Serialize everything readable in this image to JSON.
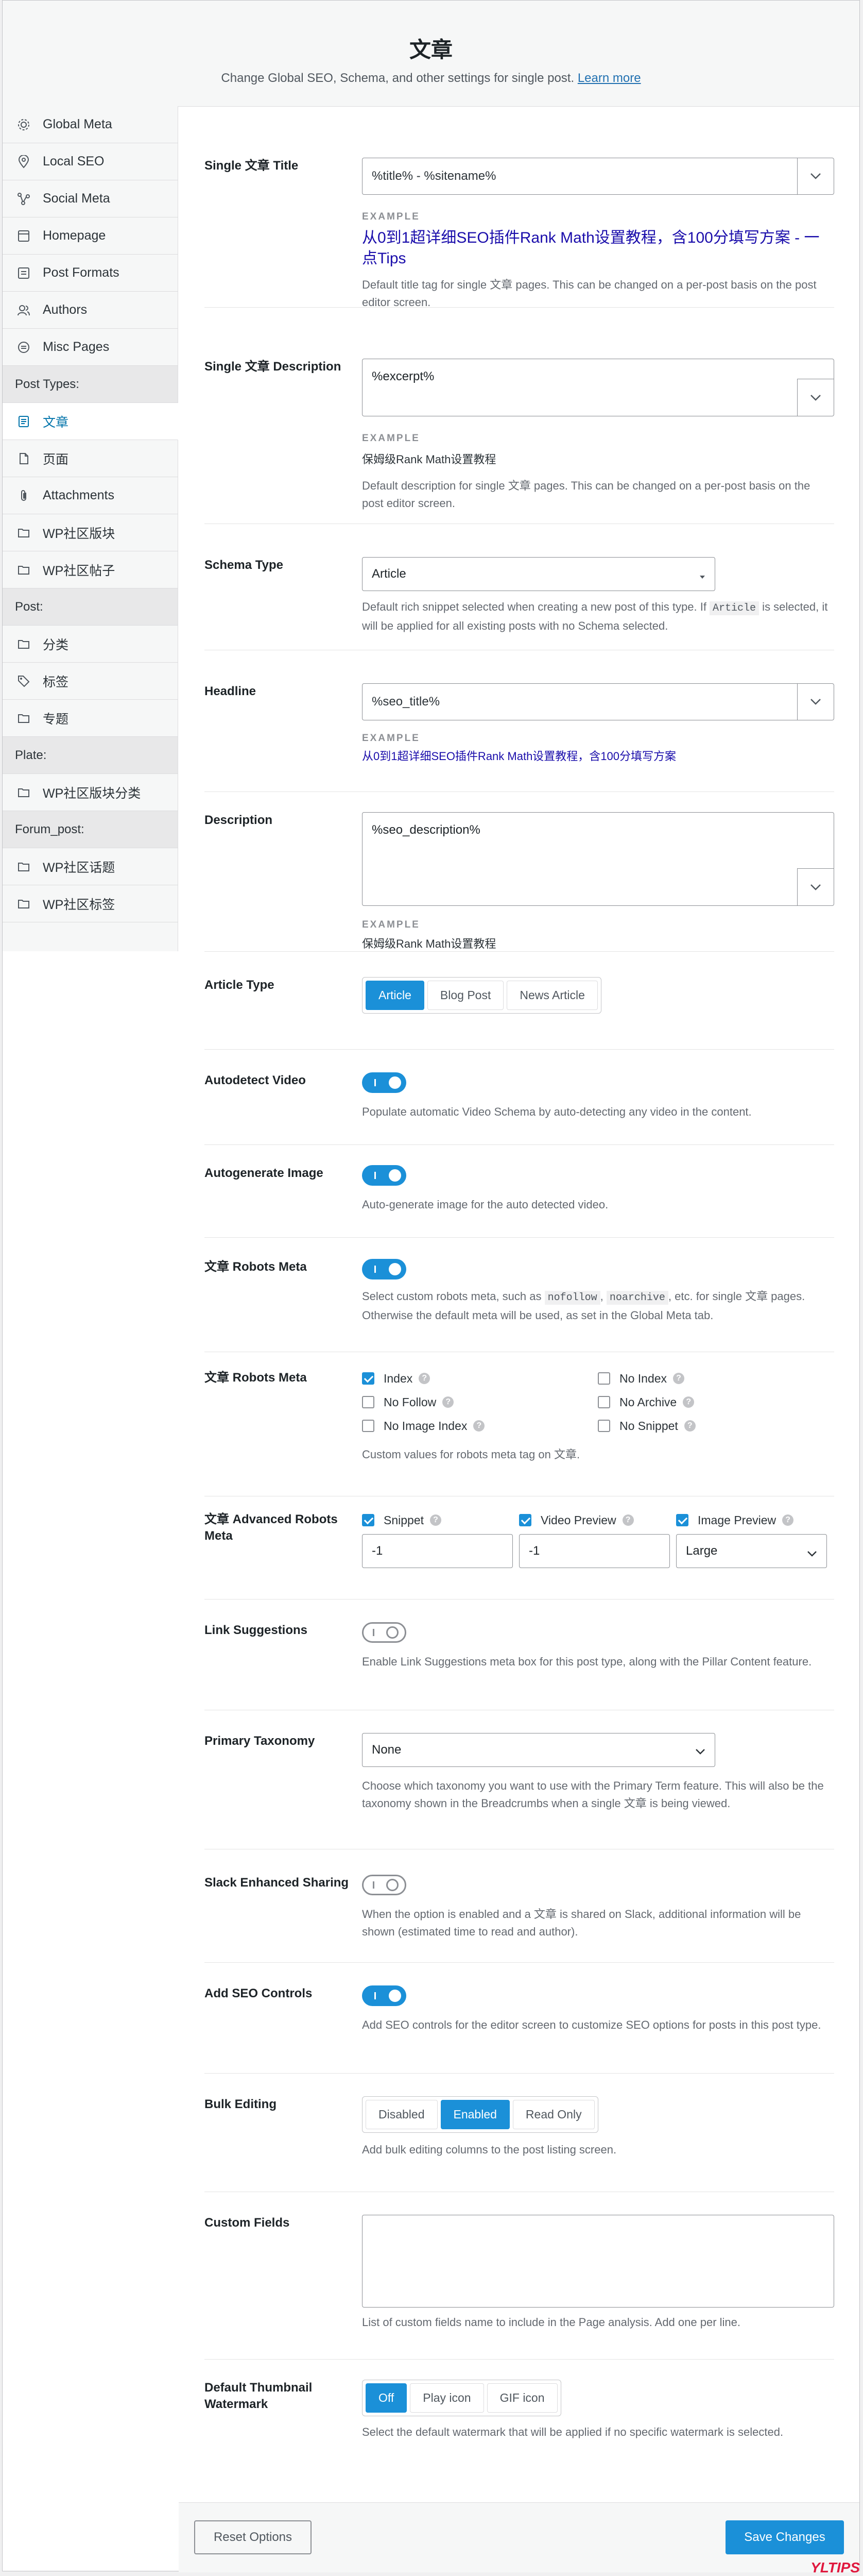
{
  "header": {
    "title": "文章",
    "subtitle": "Change Global SEO, Schema, and other settings for single post.",
    "learn_more": "Learn more"
  },
  "sidebar": {
    "items_top": [
      {
        "label": "Global Meta",
        "icon": "gear-icon"
      },
      {
        "label": "Local SEO",
        "icon": "map-pin-icon"
      },
      {
        "label": "Social Meta",
        "icon": "social-icon"
      },
      {
        "label": "Homepage",
        "icon": "home-icon"
      },
      {
        "label": "Post Formats",
        "icon": "post-format-icon"
      },
      {
        "label": "Authors",
        "icon": "users-icon"
      },
      {
        "label": "Misc Pages",
        "icon": "misc-icon"
      }
    ],
    "section_post_types": "Post Types:",
    "post_types": [
      {
        "label": "文章",
        "icon": "document-icon",
        "active": true
      },
      {
        "label": "页面",
        "icon": "page-icon"
      },
      {
        "label": "Attachments",
        "icon": "paperclip-icon"
      },
      {
        "label": "WP社区版块",
        "icon": "folder-icon"
      },
      {
        "label": "WP社区帖子",
        "icon": "folder-icon"
      }
    ],
    "section_post": "Post:",
    "post": [
      {
        "label": "分类",
        "icon": "folder-icon"
      },
      {
        "label": "标签",
        "icon": "tag-icon"
      },
      {
        "label": "专题",
        "icon": "folder-icon"
      }
    ],
    "section_plate": "Plate:",
    "plate": [
      {
        "label": "WP社区版块分类",
        "icon": "folder-icon"
      }
    ],
    "section_forum": "Forum_post:",
    "forum": [
      {
        "label": "WP社区话题",
        "icon": "folder-icon"
      },
      {
        "label": "WP社区标签",
        "icon": "folder-icon"
      }
    ]
  },
  "fields": {
    "single_title": {
      "label": "Single 文章 Title",
      "value": "%title% - %sitename%",
      "example_label": "EXAMPLE",
      "example": "从0到1超详细SEO插件Rank Math设置教程，含100分填写方案 - 一点Tips",
      "desc": "Default title tag for single 文章 pages. This can be changed on a per-post basis on the post editor screen."
    },
    "single_desc": {
      "label": "Single 文章 Description",
      "value": "%excerpt%",
      "example_label": "EXAMPLE",
      "example": "保姆级Rank Math设置教程",
      "desc": "Default description for single 文章 pages. This can be changed on a per-post basis on the post editor screen."
    },
    "schema_type": {
      "label": "Schema Type",
      "value": "Article",
      "desc_a": "Default rich snippet selected when creating a new post of this type. If ",
      "desc_code": "Article",
      "desc_b": " is selected, it will be applied for all existing posts with no Schema selected."
    },
    "headline": {
      "label": "Headline",
      "value": "%seo_title%",
      "example_label": "EXAMPLE",
      "example": "从0到1超详细SEO插件Rank Math设置教程，含100分填写方案"
    },
    "description": {
      "label": "Description",
      "value": "%seo_description%",
      "example_label": "EXAMPLE",
      "example": "保姆级Rank Math设置教程"
    },
    "article_type": {
      "label": "Article Type",
      "options": [
        "Article",
        "Blog Post",
        "News Article"
      ],
      "selected": "Article"
    },
    "autodetect_video": {
      "label": "Autodetect Video",
      "on": true,
      "desc": "Populate automatic Video Schema by auto-detecting any video in the content."
    },
    "autogenerate_image": {
      "label": "Autogenerate Image",
      "on": true,
      "desc": "Auto-generate image for the auto detected video."
    },
    "robots_meta_toggle": {
      "label": "文章 Robots Meta",
      "on": true,
      "desc_a": "Select custom robots meta, such as ",
      "code1": "nofollow",
      "desc_b": ", ",
      "code2": "noarchive",
      "desc_c": ", etc. for single 文章 pages. Otherwise the default meta will be used, as set in the Global Meta tab."
    },
    "robots_meta": {
      "label": "文章 Robots Meta",
      "options": [
        {
          "label": "Index",
          "checked": true
        },
        {
          "label": "No Index",
          "checked": false
        },
        {
          "label": "No Follow",
          "checked": false
        },
        {
          "label": "No Archive",
          "checked": false
        },
        {
          "label": "No Image Index",
          "checked": false
        },
        {
          "label": "No Snippet",
          "checked": false
        }
      ],
      "desc": "Custom values for robots meta tag on 文章."
    },
    "adv_robots": {
      "label": "文章 Advanced Robots Meta",
      "snippet": "Snippet",
      "snippet_val": "-1",
      "video": "Video Preview",
      "video_val": "-1",
      "image": "Image Preview",
      "image_val": "Large"
    },
    "link_suggestions": {
      "label": "Link Suggestions",
      "on": false,
      "desc": "Enable Link Suggestions meta box for this post type, along with the Pillar Content feature."
    },
    "primary_taxonomy": {
      "label": "Primary Taxonomy",
      "value": "None",
      "desc": "Choose which taxonomy you want to use with the Primary Term feature. This will also be the taxonomy shown in the Breadcrumbs when a single 文章 is being viewed."
    },
    "slack": {
      "label": "Slack Enhanced Sharing",
      "on": false,
      "desc": "When the option is enabled and a 文章 is shared on Slack, additional information will be shown (estimated time to read and author)."
    },
    "seo_controls": {
      "label": "Add SEO Controls",
      "on": true,
      "desc": "Add SEO controls for the editor screen to customize SEO options for posts in this post type."
    },
    "bulk_editing": {
      "label": "Bulk Editing",
      "options": [
        "Disabled",
        "Enabled",
        "Read Only"
      ],
      "selected": "Enabled",
      "desc": "Add bulk editing columns to the post listing screen."
    },
    "custom_fields": {
      "label": "Custom Fields",
      "value": "",
      "desc": "List of custom fields name to include in the Page analysis. Add one per line."
    },
    "thumb_watermark": {
      "label": "Default Thumbnail Watermark",
      "options": [
        "Off",
        "Play icon",
        "GIF icon"
      ],
      "selected": "Off",
      "desc": "Select the default watermark that will be applied if no specific watermark is selected."
    }
  },
  "footer": {
    "reset": "Reset Options",
    "save": "Save Changes"
  },
  "watermark": "YLTIPS",
  "colors": {
    "accent": "#1b90d8",
    "link": "#2271b1",
    "example": "#1a0dab"
  }
}
